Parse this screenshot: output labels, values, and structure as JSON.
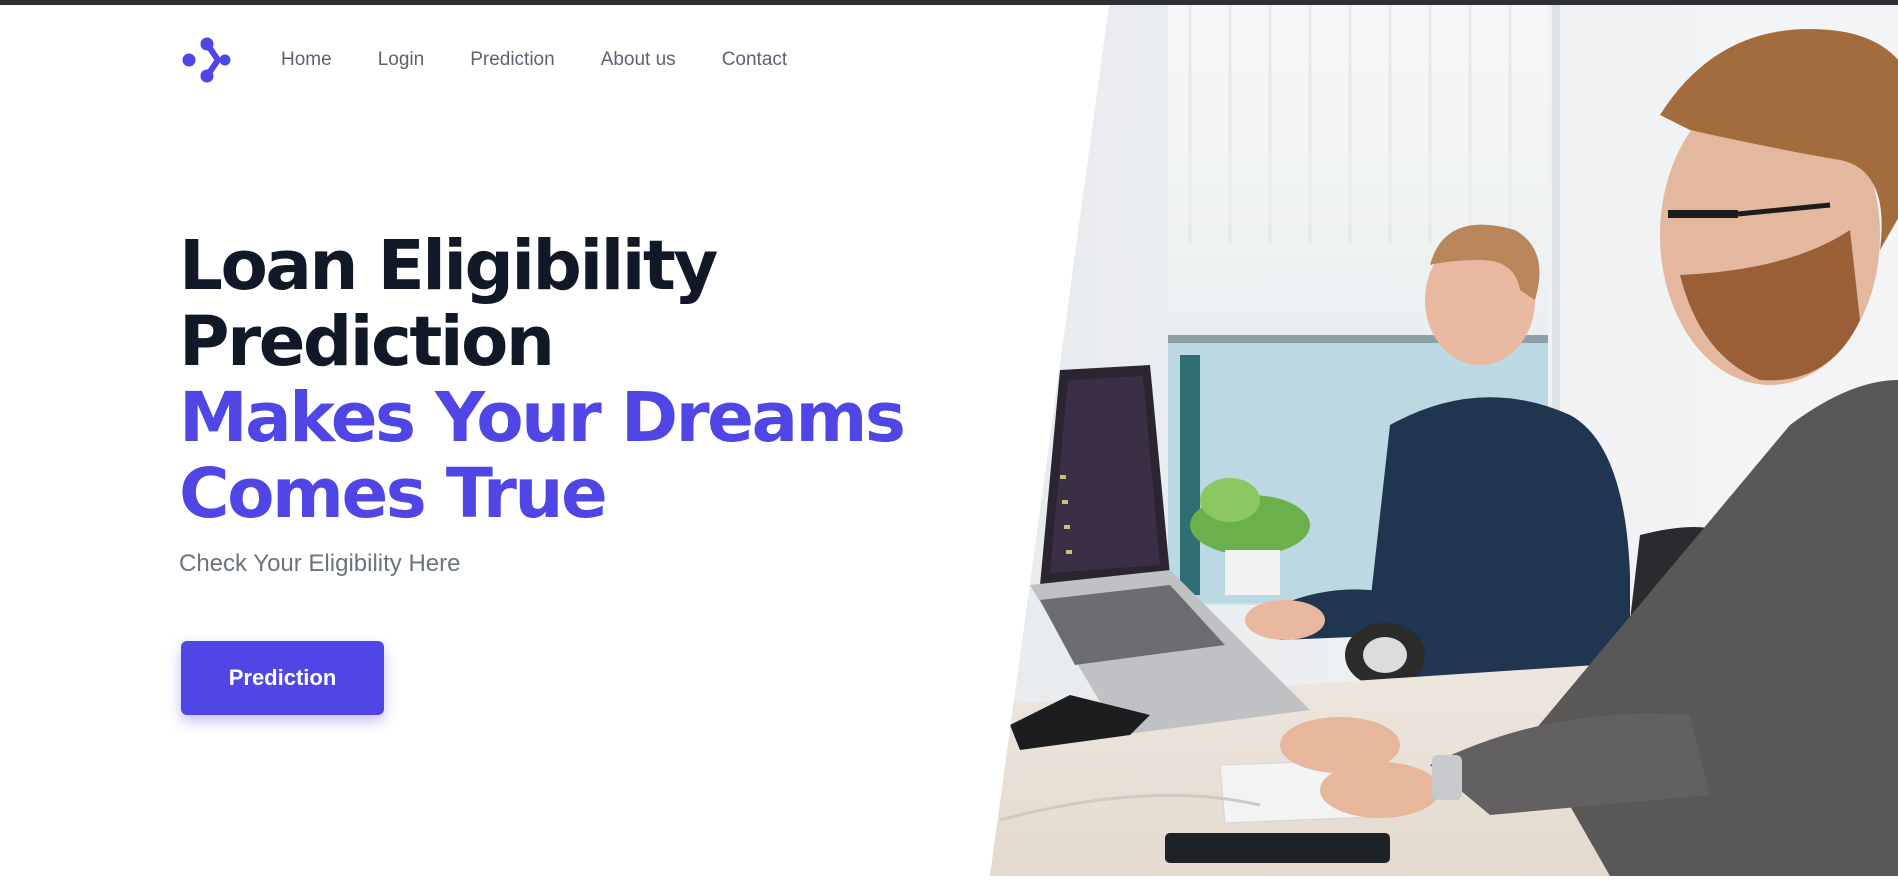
{
  "nav": {
    "logo_icon": "molecule-logo-icon",
    "links": [
      "Home",
      "Login",
      "Prediction",
      "About us",
      "Contact"
    ]
  },
  "hero": {
    "title_line1": "Loan Eligibility",
    "title_line2": "Prediction",
    "accent_line1": "Makes Your Dreams",
    "accent_line2": "Comes True",
    "subtitle": "Check Your Eligibility Here",
    "cta_label": "Prediction"
  },
  "colors": {
    "accent": "#4f46e5",
    "heading": "#111827",
    "muted": "#6b7280"
  }
}
